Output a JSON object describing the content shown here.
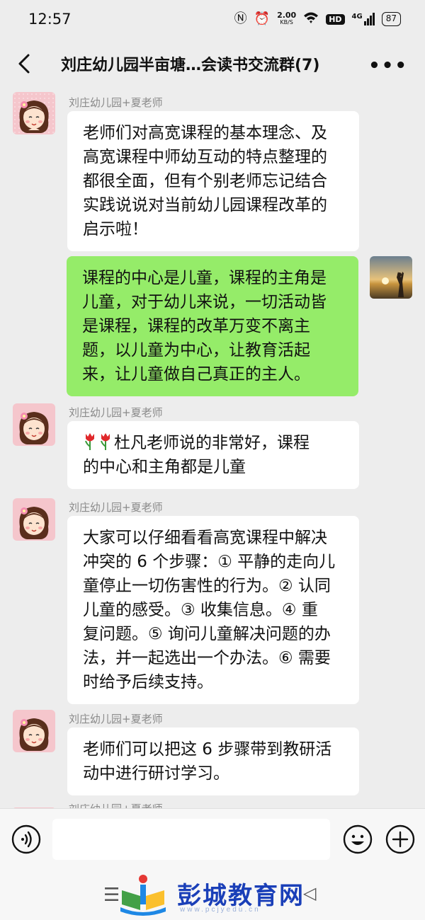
{
  "status_bar": {
    "time": "12:57",
    "net_speed": "2.00",
    "net_unit": "KB/S",
    "hd": "HD",
    "signal": "4G",
    "battery": "87"
  },
  "header": {
    "title": "刘庄幼儿园半亩塘…会读书交流群(7)"
  },
  "messages": [
    {
      "sender": "刘庄幼儿园+夏老师",
      "lines": [
        "老师们对高宽课程的基本理念、及",
        "高宽课程中师幼互动的特点整理的",
        "都很全面，但有个别老师忘记结合",
        "实践说说对当前幼儿园课程改革的",
        "启示啦！"
      ]
    },
    {
      "sender": "",
      "lines": [
        "课程的中心是儿童，课程的主角是",
        "儿童，对于幼儿来说，一切活动皆",
        "是课程，课程的改革万变不离主",
        "题，以儿童为中心，让教育活起",
        "来，让儿童做自己真正的主人。"
      ]
    },
    {
      "sender": "刘庄幼儿园+夏老师",
      "lines": [
        "杜凡老师说的非常好，课程",
        "的中心和主角都是儿童"
      ]
    },
    {
      "sender": "刘庄幼儿园+夏老师",
      "lines": [
        "大家可以仔细看看高宽课程中解决",
        "冲突的 6 个步骤：① 平静的走向儿",
        "童停止一切伤害性的行为。② 认同",
        "儿童的感受。③ 收集信息。④ 重",
        "复问题。⑤ 询问儿童解决问题的办",
        "法，并一起选出一个办法。⑥ 需要",
        "时给予后续支持。"
      ]
    },
    {
      "sender": "刘庄幼儿园+夏老师",
      "lines": [
        "老师们可以把这 6 步骤带到教研活",
        "动中进行研讨学习。"
      ]
    },
    {
      "sender": "刘庄幼儿园+夏老师"
    }
  ],
  "watermark": {
    "text": "彭城教育网",
    "url": "www.pcjyedu.cn"
  },
  "colors": {
    "background": "#ededed",
    "my_bubble": "#95ec69",
    "other_bubble": "#ffffff",
    "watermark": "#1a3fb8"
  },
  "icons": {
    "back": "chevron-left-icon",
    "more": "more-dots-icon",
    "voice": "voice-icon",
    "emoji": "emoji-icon",
    "plus": "plus-icon",
    "tulip": "tulip-icon"
  }
}
